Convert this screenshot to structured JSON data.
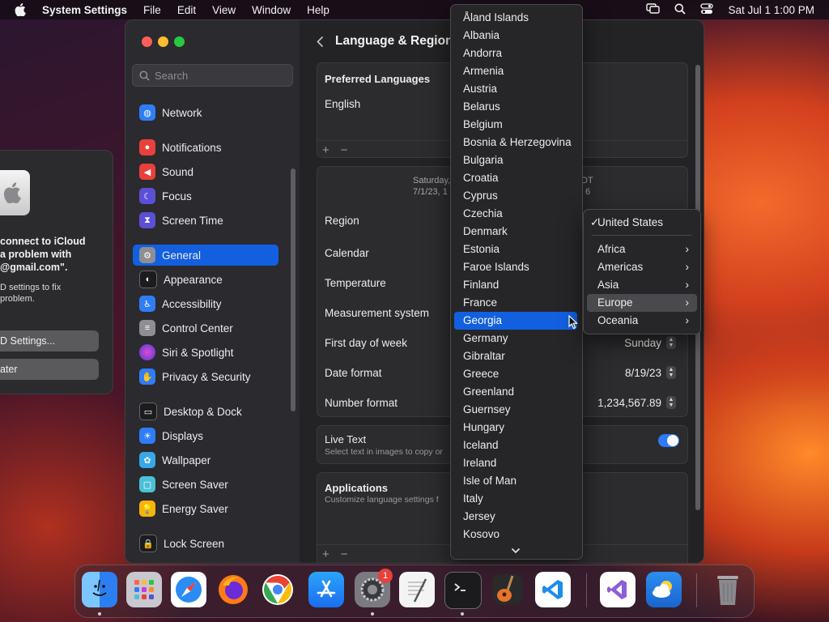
{
  "menubar": {
    "app_name": "System Settings",
    "menus": [
      "File",
      "Edit",
      "View",
      "Window",
      "Help"
    ],
    "clock": "Sat Jul 1  1:00 PM"
  },
  "background_dialog": {
    "message_line1": "connect to iCloud",
    "message_line2": "a problem with",
    "message_line3": "@gmail.com\".",
    "detail_line1": "D settings to fix",
    "detail_line2": "problem.",
    "button_primary": "D Settings...",
    "button_secondary": "ater"
  },
  "sidebar": {
    "search_placeholder": "Search",
    "items": [
      {
        "label": "Network",
        "icon": "globe-icon",
        "color": "#2f7df6"
      },
      {
        "label": "Notifications",
        "icon": "bell-icon",
        "color": "#e8413b"
      },
      {
        "label": "Sound",
        "icon": "speaker-icon",
        "color": "#e8413b"
      },
      {
        "label": "Focus",
        "icon": "moon-icon",
        "color": "#5b4fd6"
      },
      {
        "label": "Screen Time",
        "icon": "hourglass-icon",
        "color": "#5b4fd6"
      },
      {
        "label": "General",
        "icon": "gear-icon",
        "color": "#8e8e93"
      },
      {
        "label": "Appearance",
        "icon": "appearance-icon",
        "color": "#1c1c1e"
      },
      {
        "label": "Accessibility",
        "icon": "accessibility-icon",
        "color": "#2f7df6"
      },
      {
        "label": "Control Center",
        "icon": "toggles-icon",
        "color": "#8e8e93"
      },
      {
        "label": "Siri & Spotlight",
        "icon": "siri-icon",
        "color": "#c43de0"
      },
      {
        "label": "Privacy & Security",
        "icon": "hand-icon",
        "color": "#2f7df6"
      },
      {
        "label": "Desktop & Dock",
        "icon": "dock-icon",
        "color": "#1c1c1e"
      },
      {
        "label": "Displays",
        "icon": "sun-icon",
        "color": "#2f7df6"
      },
      {
        "label": "Wallpaper",
        "icon": "flower-icon",
        "color": "#37a8e8"
      },
      {
        "label": "Screen Saver",
        "icon": "screensaver-icon",
        "color": "#4cc0d8"
      },
      {
        "label": "Energy Saver",
        "icon": "bulb-icon",
        "color": "#f5b40a"
      },
      {
        "label": "Lock Screen",
        "icon": "lock-icon",
        "color": "#1c1c1e"
      }
    ],
    "selected": "General"
  },
  "header": {
    "title": "Language & Region"
  },
  "preferred_languages": {
    "title": "Preferred Languages",
    "languages": [
      "English"
    ]
  },
  "preview": {
    "line1": "Saturday,",
    "line1_right": "DT",
    "line2": "7/1/23, 1",
    "line2_right": "6"
  },
  "settings_rows": [
    {
      "label": "Region",
      "value": ""
    },
    {
      "label": "Calendar",
      "value": ""
    },
    {
      "label": "Temperature",
      "value": ""
    },
    {
      "label": "Measurement system",
      "value": ""
    },
    {
      "label": "First day of week",
      "value": "Sunday"
    },
    {
      "label": "Date format",
      "value": "8/19/23"
    },
    {
      "label": "Number format",
      "value": "1,234,567.89"
    }
  ],
  "live_text": {
    "title": "Live Text",
    "subtitle": "Select text in images to copy or",
    "enabled": true
  },
  "applications": {
    "title": "Applications",
    "subtitle": "Customize language settings f"
  },
  "controls": {
    "add": "+",
    "remove": "−"
  },
  "dropdown": {
    "items": [
      "Åland Islands",
      "Albania",
      "Andorra",
      "Armenia",
      "Austria",
      "Belarus",
      "Belgium",
      "Bosnia & Herzegovina",
      "Bulgaria",
      "Croatia",
      "Cyprus",
      "Czechia",
      "Denmark",
      "Estonia",
      "Faroe Islands",
      "Finland",
      "France",
      "Georgia",
      "Germany",
      "Gibraltar",
      "Greece",
      "Greenland",
      "Guernsey",
      "Hungary",
      "Iceland",
      "Ireland",
      "Isle of Man",
      "Italy",
      "Jersey",
      "Kosovo"
    ],
    "highlighted": "Georgia",
    "more_indicator": "chevron-down-icon"
  },
  "region_menu": {
    "checked_item": "United States",
    "checkmark": "✓",
    "regions": [
      "Africa",
      "Americas",
      "Asia",
      "Europe",
      "Oceania"
    ],
    "highlighted": "Europe",
    "chevron": "›"
  },
  "dock": {
    "apps": [
      {
        "name": "finder-icon",
        "color": "#3b8df0"
      },
      {
        "name": "launchpad-icon",
        "color": "#b0b0b8"
      },
      {
        "name": "safari-icon",
        "color": "#ffffff"
      },
      {
        "name": "firefox-icon",
        "color": "#ff7a18"
      },
      {
        "name": "chrome-icon",
        "color": "#ffffff"
      },
      {
        "name": "app-store-icon",
        "color": "#1d8cf8"
      },
      {
        "name": "system-settings-icon",
        "color": "#8e8e93"
      },
      {
        "name": "textedit-icon",
        "color": "#f4f4f4"
      },
      {
        "name": "terminal-icon",
        "color": "#1b1b1d"
      },
      {
        "name": "garageband-icon",
        "color": "#222222"
      },
      {
        "name": "vscode-icon",
        "color": "#ffffff"
      },
      {
        "name": "visual-studio-icon",
        "color": "#ffffff"
      },
      {
        "name": "weather-icon",
        "color": "#2d8ef0"
      },
      {
        "name": "trash-icon",
        "color": "#8a8a8e"
      }
    ],
    "settings_badge": "1"
  }
}
